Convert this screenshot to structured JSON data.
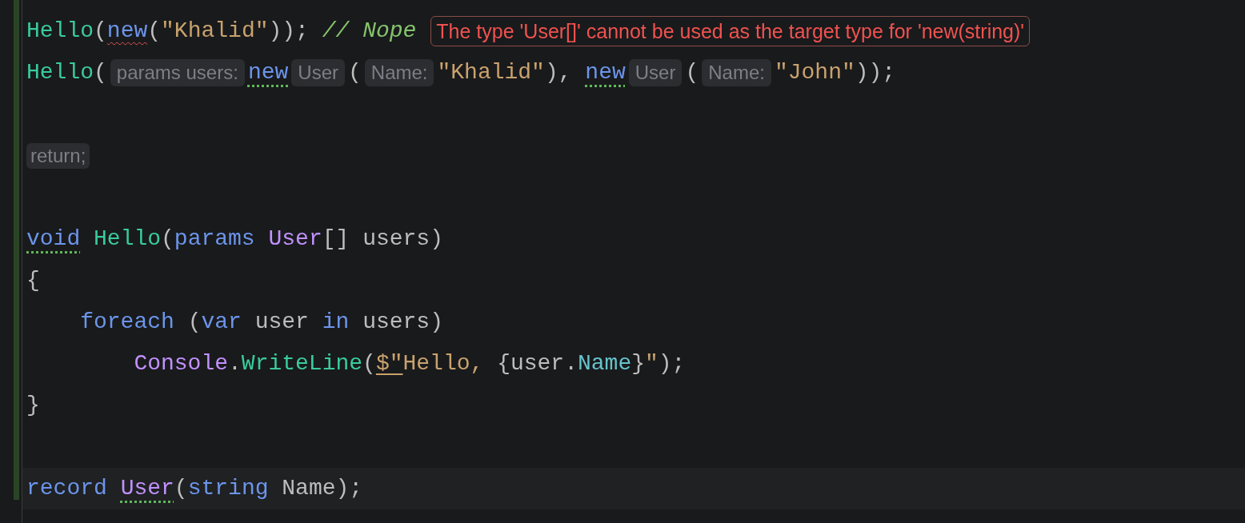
{
  "lines": [
    {
      "current": false,
      "tokens": [
        {
          "kind": "method",
          "text": "Hello"
        },
        {
          "kind": "punct",
          "text": "("
        },
        {
          "kind": "keyword",
          "text": "new",
          "error_underline": true
        },
        {
          "kind": "punct",
          "text": "("
        },
        {
          "kind": "string",
          "text": "\"Khalid\""
        },
        {
          "kind": "punct",
          "text": "));"
        },
        {
          "kind": "comment",
          "text": "// Nope",
          "space_before": true
        },
        {
          "kind": "error_popup",
          "text": "The type 'User[]' cannot be used as the target type for 'new(string)'"
        }
      ]
    },
    {
      "current": false,
      "tokens": [
        {
          "kind": "method",
          "text": "Hello"
        },
        {
          "kind": "punct",
          "text": "("
        },
        {
          "kind": "hint",
          "text": "params users:"
        },
        {
          "kind": "keyword",
          "text": "new",
          "dotted_underline": true
        },
        {
          "kind": "hint",
          "text": "User"
        },
        {
          "kind": "punct",
          "text": "("
        },
        {
          "kind": "hint",
          "text": "Name:"
        },
        {
          "kind": "string",
          "text": "\"Khalid\""
        },
        {
          "kind": "punct",
          "text": "),"
        },
        {
          "kind": "keyword",
          "text": "new",
          "dotted_underline": true,
          "space_before": true
        },
        {
          "kind": "hint",
          "text": "User"
        },
        {
          "kind": "punct",
          "text": "("
        },
        {
          "kind": "hint",
          "text": "Name:"
        },
        {
          "kind": "string",
          "text": "\"John\""
        },
        {
          "kind": "punct",
          "text": "));"
        }
      ]
    },
    {
      "current": false
    },
    {
      "current": false,
      "tokens": [
        {
          "kind": "fold",
          "text": "return;"
        }
      ]
    },
    {
      "current": false
    },
    {
      "current": false,
      "tokens": [
        {
          "kind": "keyword",
          "text": "void",
          "dotted_underline": true
        },
        {
          "kind": "method",
          "text": "Hello",
          "space_before": true
        },
        {
          "kind": "punct",
          "text": "("
        },
        {
          "kind": "keyword",
          "text": "params"
        },
        {
          "kind": "type",
          "text": "User",
          "space_before": true
        },
        {
          "kind": "punct",
          "text": "[]"
        },
        {
          "kind": "ident",
          "text": "users",
          "space_before": true
        },
        {
          "kind": "punct",
          "text": ")"
        }
      ]
    },
    {
      "current": false,
      "tokens": [
        {
          "kind": "punct",
          "text": "{"
        }
      ],
      "children": [
        {
          "current": false,
          "tokens": [
            {
              "kind": "keyword",
              "text": "foreach"
            },
            {
              "kind": "punct",
              "text": "(",
              "space_before": true
            },
            {
              "kind": "keyword",
              "text": "var"
            },
            {
              "kind": "ident",
              "text": "user",
              "space_before": true
            },
            {
              "kind": "keyword",
              "text": "in",
              "space_before": true
            },
            {
              "kind": "ident",
              "text": "users",
              "space_before": true
            },
            {
              "kind": "punct",
              "text": ")"
            }
          ],
          "children": [
            {
              "current": false,
              "tokens": [
                {
                  "kind": "type",
                  "text": "Console"
                },
                {
                  "kind": "punct",
                  "text": "."
                },
                {
                  "kind": "method",
                  "text": "WriteLine"
                },
                {
                  "kind": "punct",
                  "text": "("
                },
                {
                  "kind": "string",
                  "text": "$\"",
                  "underline": true
                },
                {
                  "kind": "string",
                  "text": "Hello,"
                },
                {
                  "kind": "punct",
                  "text": "{",
                  "space_before": true
                },
                {
                  "kind": "ident",
                  "text": "user"
                },
                {
                  "kind": "punct",
                  "text": "."
                },
                {
                  "kind": "property",
                  "text": "Name"
                },
                {
                  "kind": "punct",
                  "text": "}"
                },
                {
                  "kind": "string",
                  "text": "\""
                },
                {
                  "kind": "punct",
                  "text": ");"
                }
              ]
            }
          ]
        }
      ]
    },
    {
      "current": false,
      "tokens": [
        {
          "kind": "punct",
          "text": "}"
        }
      ]
    },
    {
      "current": false
    },
    {
      "current": true,
      "tokens": [
        {
          "kind": "keyword",
          "text": "record"
        },
        {
          "kind": "type",
          "text": "User",
          "dotted_underline": true,
          "space_before": true
        },
        {
          "kind": "punct",
          "text": "("
        },
        {
          "kind": "keyword",
          "text": "string"
        },
        {
          "kind": "ident",
          "text": "Name",
          "space_before": true
        },
        {
          "kind": "punct",
          "text": ");"
        }
      ]
    }
  ]
}
